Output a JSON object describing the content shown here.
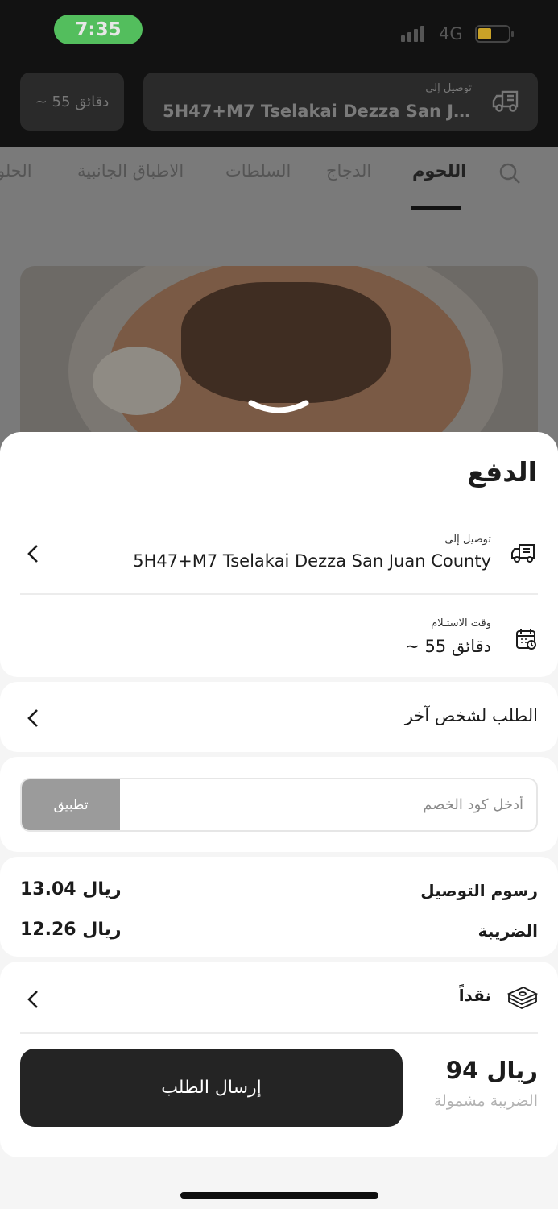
{
  "status_bar": {
    "time": "7:35",
    "network": "4G"
  },
  "background": {
    "eta": "~ 55 دقائق",
    "delivery_label": "توصيل إلى",
    "delivery_address": "5H47+M7 Tselakai Dezza San Juan...",
    "categories": [
      "اللحوم",
      "الدجاج",
      "السلطات",
      "الاطباق الجانبية",
      "الحلو"
    ]
  },
  "sheet": {
    "title": "الدفع",
    "delivery": {
      "label": "توصيل إلى",
      "address": "5H47+M7 Tselakai Dezza San Juan County"
    },
    "pickup": {
      "label": "وقت الاستـلام",
      "value": "~ 55 دقائق"
    },
    "order_for_other": "الطلب لشخص آخر",
    "coupon": {
      "placeholder": "أدخل كود الخصم",
      "apply_label": "تطبيق"
    },
    "fees": [
      {
        "label": "رسوم التوصيل",
        "value": "13.04 ريال"
      },
      {
        "label": "الضريبة",
        "value": "12.26 ريال"
      }
    ],
    "payment_method": "نقداً",
    "total": "94 ريال",
    "vat_note": "الضريبة مشمولة",
    "submit_label": "إرسال الطلب"
  }
}
